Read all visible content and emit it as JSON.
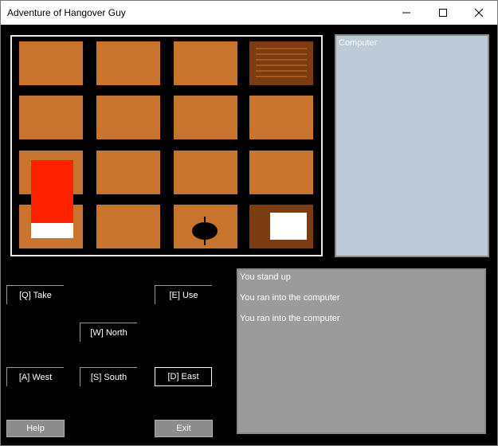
{
  "window": {
    "title": "Adventure of Hangover Guy"
  },
  "titlebar_controls": {
    "minimize_icon": "minimize-icon",
    "maximize_icon": "maximize-icon",
    "close_icon": "close-icon"
  },
  "board": {
    "rows": 4,
    "cols": 4,
    "tile_color": "#c8742d",
    "objects": {
      "shelf": "bookshelf",
      "fridge": "fridge",
      "player": "hangover-guy",
      "computer": "computer"
    }
  },
  "info_panel": {
    "label": "Computer"
  },
  "controls": {
    "take": "[Q] Take",
    "use": "[E] Use",
    "north": "[W] North",
    "west": "[A] West",
    "south": "[S] South",
    "east": "[D] East",
    "help": "Help",
    "exit": "Exit"
  },
  "log": {
    "lines": [
      "You stand up",
      "You ran into the computer",
      "You ran into the computer"
    ]
  },
  "colors": {
    "background": "#000000",
    "info_panel": "#bdcad8",
    "log_panel": "#9b9b9b",
    "fridge": "#ff2200"
  }
}
